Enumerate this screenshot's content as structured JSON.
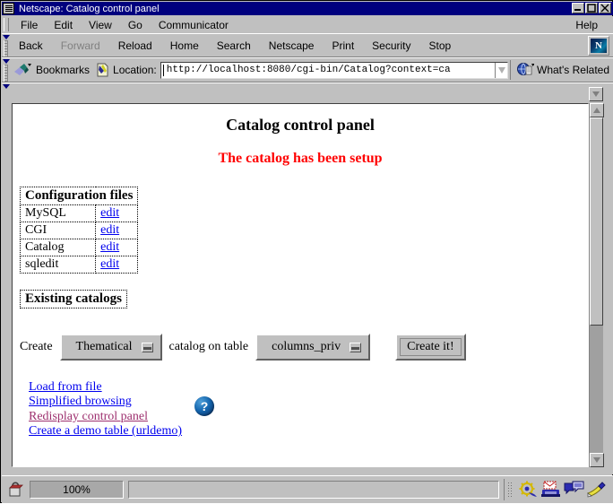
{
  "window": {
    "title": "Netscape: Catalog control panel",
    "system_menu_icon": "window-menu-icon",
    "minimize_label": "Minimize",
    "maximize_label": "Maximize",
    "close_label": "Close"
  },
  "menubar": {
    "items": [
      {
        "label": "File"
      },
      {
        "label": "Edit"
      },
      {
        "label": "View"
      },
      {
        "label": "Go"
      },
      {
        "label": "Communicator"
      }
    ],
    "help_label": "Help"
  },
  "navbar": {
    "buttons": [
      {
        "label": "Back",
        "disabled": false
      },
      {
        "label": "Forward",
        "disabled": true
      },
      {
        "label": "Reload",
        "disabled": false
      },
      {
        "label": "Home",
        "disabled": false
      },
      {
        "label": "Search",
        "disabled": false
      },
      {
        "label": "Netscape",
        "disabled": false
      },
      {
        "label": "Print",
        "disabled": false
      },
      {
        "label": "Security",
        "disabled": false
      },
      {
        "label": "Stop",
        "disabled": false
      }
    ],
    "logo_letter": "N"
  },
  "locationbar": {
    "bookmarks_label": "Bookmarks",
    "location_label": "Location:",
    "url_value": "http://localhost:8080/cgi-bin/Catalog?context=ca",
    "url_placeholder": "Enter URL",
    "whats_related_label": "What's Related"
  },
  "page": {
    "heading": "Catalog control panel",
    "status_message": "The catalog has been setup",
    "status_color": "#ff0000",
    "config_table": {
      "header": "Configuration files",
      "rows": [
        {
          "name": "MySQL",
          "action": "edit"
        },
        {
          "name": "CGI",
          "action": "edit"
        },
        {
          "name": "Catalog",
          "action": "edit"
        },
        {
          "name": "sqledit",
          "action": "edit"
        }
      ]
    },
    "existing_catalogs_header": "Existing catalogs",
    "create_form": {
      "prefix_label": "Create",
      "catalog_type_selected": "Thematical",
      "middle_label": "catalog on table",
      "table_selected": "columns_priv",
      "submit_label": "Create it!"
    },
    "links": [
      {
        "label": "Load from file",
        "visited": false
      },
      {
        "label": "Simplified browsing",
        "visited": false
      },
      {
        "label": "Redisplay control panel",
        "visited": true
      },
      {
        "label": "Create a demo table (urldemo)",
        "visited": false
      }
    ],
    "help_badge": "?",
    "link_color": "#0000ee",
    "visited_link_color": "#9d2f6e"
  },
  "statusbar": {
    "security_icon": "unlocked-padlock-icon",
    "progress_text": "100%",
    "message": "",
    "component_icons": [
      "navigator-icon",
      "mailbox-icon",
      "newsgroups-icon",
      "composer-icon"
    ]
  }
}
